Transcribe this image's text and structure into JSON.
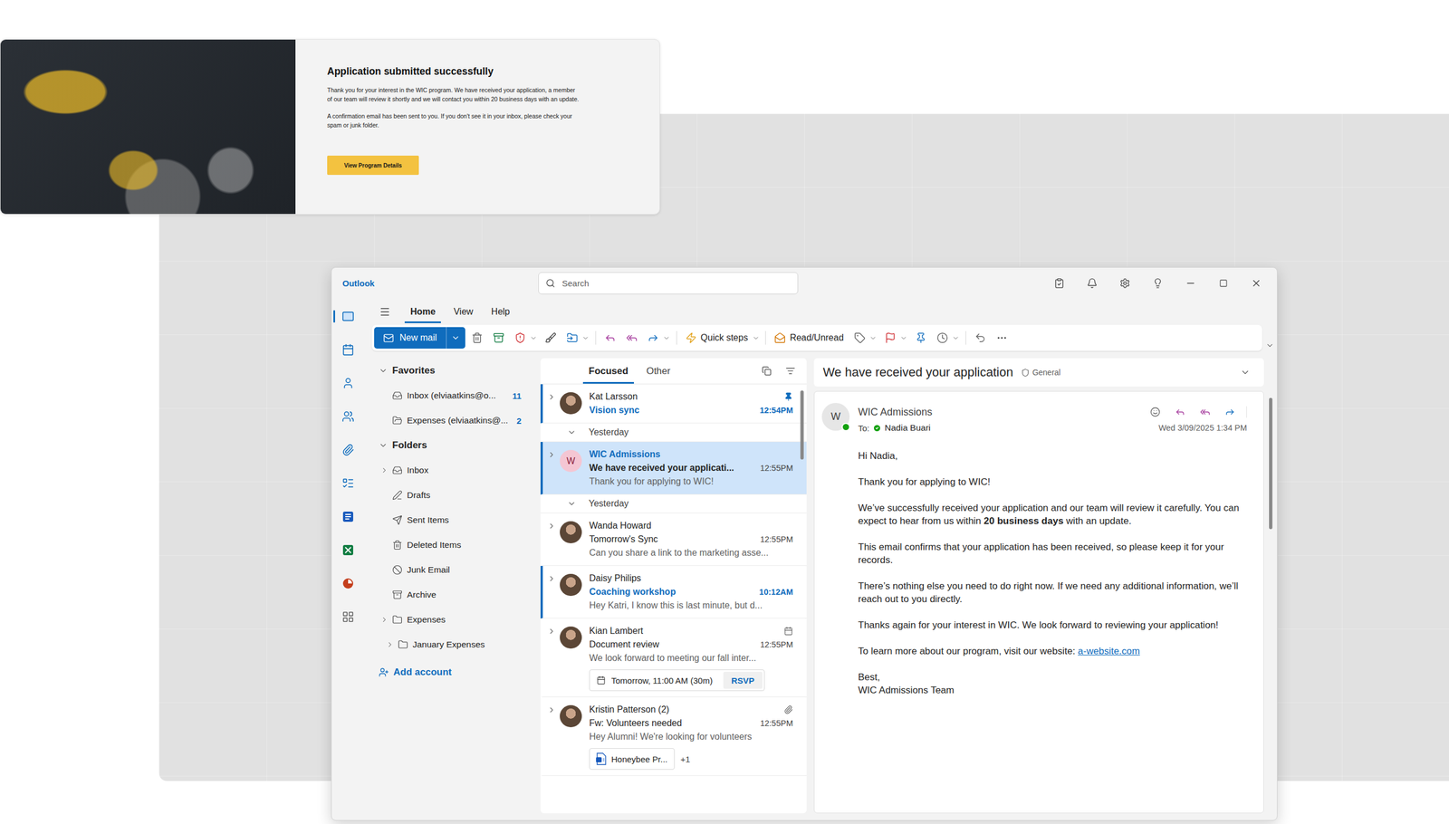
{
  "confirmation": {
    "title": "Application submitted successfully",
    "paragraphs": [
      "Thank you for your interest in the WIC program. We have received your application, a member of our team will review it shortly and we will contact you within 20 business days with an update.",
      "A confirmation email has been sent to you. If you don't see it in your inbox, please check your spam or junk folder."
    ],
    "button": "View Program Details"
  },
  "window": {
    "title": "Outlook",
    "search": {
      "placeholder": "Search"
    }
  },
  "app_rail": [
    {
      "kind": "mail",
      "selected": true
    },
    {
      "kind": "calendar",
      "selected": false
    },
    {
      "kind": "people",
      "selected": false
    },
    {
      "kind": "groups",
      "selected": false
    },
    {
      "kind": "files",
      "selected": false
    },
    {
      "kind": "todo",
      "selected": false
    },
    {
      "kind": "word",
      "selected": false
    },
    {
      "kind": "excel",
      "selected": false
    },
    {
      "kind": "powerpoint",
      "selected": false
    },
    {
      "kind": "apps",
      "selected": false
    }
  ],
  "ribbon": {
    "tabs": [
      {
        "label": "Home",
        "selected": true
      },
      {
        "label": "View",
        "selected": false
      },
      {
        "label": "Help",
        "selected": false
      }
    ],
    "new_mail": "New mail",
    "quick_steps": "Quick steps",
    "read_unread": "Read/Unread"
  },
  "folder_pane": {
    "sections": [
      {
        "label": "Favorites",
        "expanded": true,
        "items": [
          {
            "label": "Inbox (elviaatkins@o...",
            "kind": "inbox",
            "count": "11",
            "has_children": false,
            "expanded": false,
            "nested": false
          },
          {
            "label": "Expenses (elviaatkins@...",
            "kind": "expenses",
            "count": "2",
            "has_children": false,
            "expanded": false,
            "nested": false
          }
        ]
      },
      {
        "label": "Folders",
        "expanded": true,
        "items": [
          {
            "label": "Inbox",
            "kind": "inbox",
            "count": "",
            "has_children": true,
            "expanded": false,
            "nested": false
          },
          {
            "label": "Drafts",
            "kind": "drafts",
            "count": "",
            "has_children": false,
            "expanded": false,
            "nested": false
          },
          {
            "label": "Sent Items",
            "kind": "sent",
            "count": "",
            "has_children": false,
            "expanded": false,
            "nested": false
          },
          {
            "label": "Deleted Items",
            "kind": "deleted",
            "count": "",
            "has_children": false,
            "expanded": false,
            "nested": false
          },
          {
            "label": "Junk Email",
            "kind": "junk",
            "count": "",
            "has_children": false,
            "expanded": false,
            "nested": false
          },
          {
            "label": "Archive",
            "kind": "archive",
            "count": "",
            "has_children": false,
            "expanded": false,
            "nested": false
          },
          {
            "label": "Expenses",
            "kind": "folder",
            "count": "",
            "has_children": true,
            "expanded": false,
            "nested": false
          },
          {
            "label": "January Expenses",
            "kind": "folder",
            "count": "",
            "has_children": true,
            "expanded": false,
            "nested": true
          }
        ]
      }
    ],
    "add_account": "Add account"
  },
  "message_list": {
    "tabs": [
      {
        "label": "Focused",
        "selected": true
      },
      {
        "label": "Other",
        "selected": false
      }
    ],
    "rows": [
      {
        "kind": "message",
        "sender": "Kat Larsson",
        "subject": "Vision sync",
        "time": "12:54PM",
        "selected": false,
        "unread": true,
        "pinned": true,
        "expanded": false,
        "avatar_initial": ""
      },
      {
        "kind": "group",
        "label": "Yesterday",
        "expanded": true
      },
      {
        "kind": "message",
        "sender": "WIC Admissions",
        "subject": "We have received your applicati...",
        "preview": "Thank you for applying to WIC!",
        "time": "12:55PM",
        "selected": true,
        "unread": false,
        "pinned": false,
        "expanded": false,
        "avatar_initial": "W"
      },
      {
        "kind": "group",
        "label": "Yesterday",
        "expanded": true
      },
      {
        "kind": "message",
        "sender": "Wanda Howard",
        "subject": "Tomorrow's Sync",
        "preview": "Can you share a link to the marketing asse...",
        "time": "12:55PM",
        "selected": false,
        "unread": false,
        "pinned": false,
        "expanded": false,
        "avatar_initial": ""
      },
      {
        "kind": "message",
        "sender": "Daisy Philips",
        "subject": "Coaching workshop",
        "preview": "Hey Katri, I know this is last minute, but d...",
        "time": "10:12AM",
        "selected": false,
        "unread": true,
        "pinned": false,
        "expanded": false,
        "avatar_initial": ""
      },
      {
        "kind": "message",
        "sender": "Kian Lambert",
        "subject": "Document review",
        "preview": "We look forward to meeting our fall inter...",
        "time": "12:55PM",
        "selected": false,
        "unread": false,
        "pinned": false,
        "expanded": false,
        "avatar_initial": "",
        "meeting": {
          "time": "Tomorrow, 11:00 AM (30m)",
          "action": "RSVP"
        }
      },
      {
        "kind": "message",
        "sender": "Kristin Patterson (2)",
        "subject": "Fw: Volunteers needed",
        "preview": "Hey Alumni! We're looking for volunteers",
        "time": "12:55PM",
        "selected": false,
        "unread": false,
        "pinned": false,
        "expanded": false,
        "avatar_initial": "",
        "attachment": {
          "name": "Honeybee Pr...",
          "more": "+1"
        }
      }
    ]
  },
  "reading_pane": {
    "subject": "We have received your application",
    "label": "General",
    "sender": "WIC Admissions",
    "sender_initial": "W",
    "sender_online": true,
    "to_label": "To:",
    "recipient": "Nadia Buari",
    "recipient_verified": true,
    "date": "Wed 3/09/2025 1:34 PM",
    "body": [
      [
        {
          "text": "Hi Nadia,",
          "kind": "text"
        }
      ],
      [
        {
          "text": "Thank you for applying to WIC!",
          "kind": "text"
        }
      ],
      [
        {
          "text": "We’ve successfully received your application and our team will review it carefully. You can expect to hear from us within ",
          "kind": "text"
        },
        {
          "text": "20 business days",
          "kind": "bold"
        },
        {
          "text": " with an update.",
          "kind": "text"
        }
      ],
      [
        {
          "text": "This email confirms that your application has been received, so please keep it for your records.",
          "kind": "text"
        }
      ],
      [
        {
          "text": "There’s nothing else you need to do right now. If we need any additional information, we’ll reach out to you directly.",
          "kind": "text"
        }
      ],
      [
        {
          "text": "Thanks again for your interest in WIC. We look forward to reviewing your application!",
          "kind": "text"
        }
      ],
      [
        {
          "text": "To learn more about our program, visit our website: ",
          "kind": "text"
        },
        {
          "text": "a-website.com",
          "kind": "link"
        }
      ]
    ],
    "signature": [
      "Best,",
      "WIC Admissions Team"
    ]
  }
}
